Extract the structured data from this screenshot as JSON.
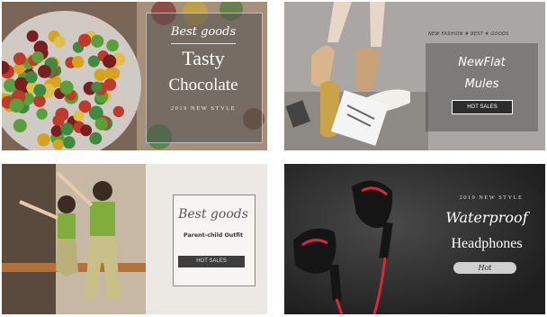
{
  "cards": [
    {
      "id": "chocolate",
      "brand": "Best goods",
      "title_line1": "Tasty",
      "title_line2": "Chocolate",
      "caption": "2019 NEW STYLE"
    },
    {
      "id": "mules",
      "tagline": "NEW FASHION # BEST # GOODS",
      "title_line1": "NewFlat",
      "title_line2": "Mules",
      "button": "HOT SALES"
    },
    {
      "id": "outfit",
      "title": "Best goods",
      "subtitle": "Parent-child Outfit",
      "button": "HOT SALES"
    },
    {
      "id": "headphones",
      "caption": "2019 NEW STYLE",
      "title_line1": "Waterproof",
      "title_line2": "Headphones",
      "button": "Hot"
    }
  ],
  "colors": {
    "dark_panel": "#2d2d2d",
    "headphone_red": "#d8283a",
    "overlay_gray": "#555555"
  }
}
